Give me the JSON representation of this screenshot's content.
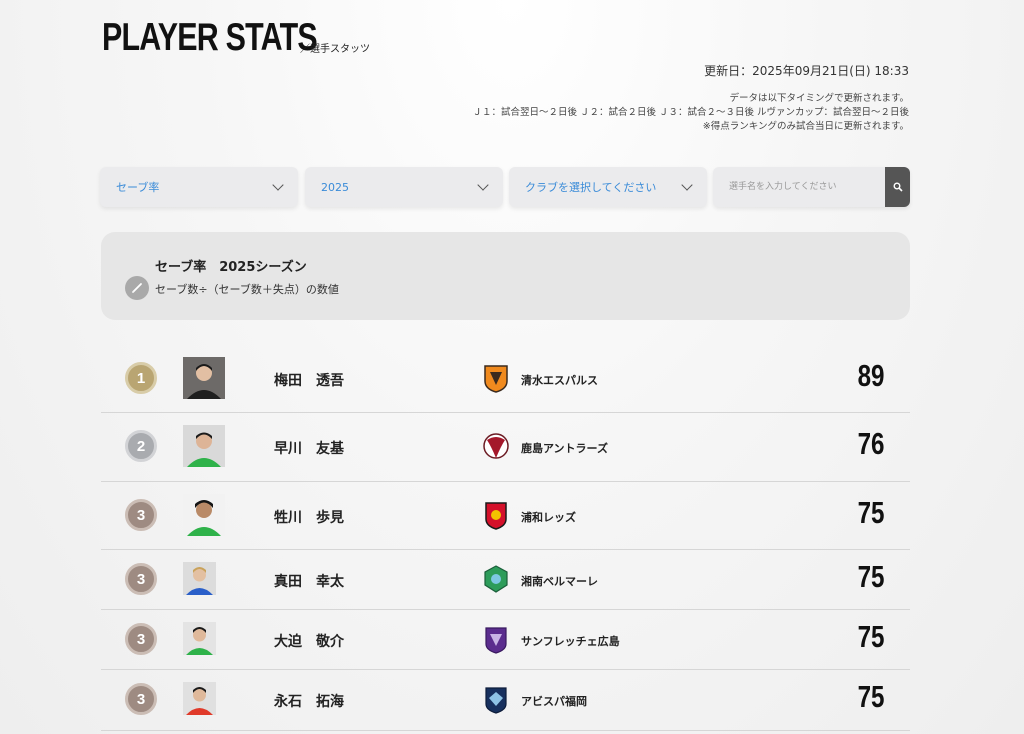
{
  "header": {
    "title": "PLAYER STATS",
    "subtitle": "／選手スタッツ",
    "updated": "更新日：2025年09月21日(日) 18:33",
    "notes": [
      "データは以下タイミングで更新されます。",
      "Ｊ１：試合翌日〜２日後 Ｊ２：試合２日後 Ｊ３：試合２〜３日後 ルヴァンカップ：試合翌日〜２日後",
      "※得点ランキングのみ試合当日に更新されます。"
    ]
  },
  "filters": {
    "stat": "セーブ率",
    "season": "2025",
    "club": "クラブを選択してください",
    "search_placeholder": "選手名を入力してください"
  },
  "info": {
    "title": "セーブ率　2025シーズン",
    "description": "セーブ数÷（セーブ数＋失点）の数値"
  },
  "rankings": [
    {
      "rank": "1",
      "name": "梅田　透吾",
      "club": "清水エスパルス",
      "value": "89"
    },
    {
      "rank": "2",
      "name": "早川　友基",
      "club": "鹿島アントラーズ",
      "value": "76"
    },
    {
      "rank": "3",
      "name": "牲川　歩見",
      "club": "浦和レッズ",
      "value": "75"
    },
    {
      "rank": "3",
      "name": "真田　幸太",
      "club": "湘南ベルマーレ",
      "value": "75"
    },
    {
      "rank": "3",
      "name": "大迫　敬介",
      "club": "サンフレッチェ広島",
      "value": "75"
    },
    {
      "rank": "3",
      "name": "永石　拓海",
      "club": "アビスパ福岡",
      "value": "75"
    }
  ],
  "colors": {
    "accent": "#3a8bd8",
    "gold": "#b9a572",
    "silver": "#a9abaf",
    "bronze": "#9e8b82"
  }
}
